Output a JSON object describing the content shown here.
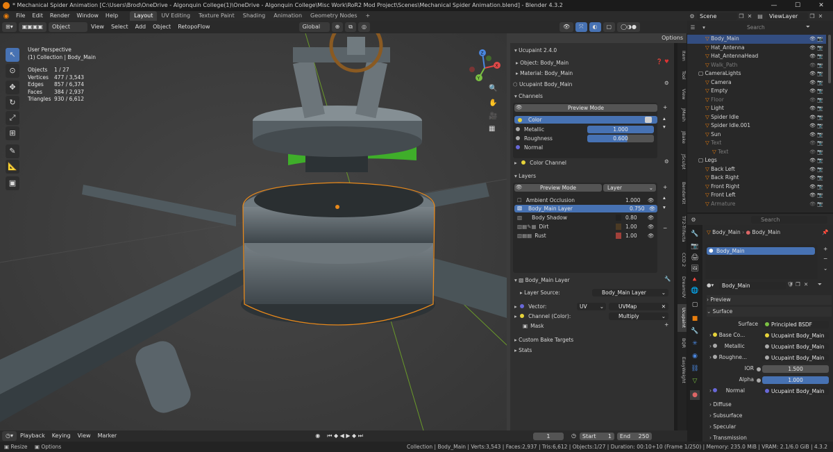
{
  "window": {
    "title": "* Mechanical Spider Animation [C:\\Users\\Brod\\OneDrive - Algonquin College(1)\\OneDrive - Algonquin College\\Misc Work\\RoR2 Mod Project\\Scenes\\Mechanical Spider Animation.blend] - Blender 4.3.2",
    "minimize": "—",
    "maximize": "☐",
    "close": "✕"
  },
  "menu": [
    "File",
    "Edit",
    "Render",
    "Window",
    "Help"
  ],
  "workspaces": [
    "Layout",
    "UV Editing",
    "Texture Paint",
    "Shading",
    "Animation",
    "Geometry Nodes"
  ],
  "scene": {
    "label": "Scene",
    "viewlayer": "ViewLayer"
  },
  "viewport_header": {
    "mode": "Object Mode",
    "items": [
      "View",
      "Select",
      "Add",
      "Object"
    ],
    "addon": "RetopoFlow",
    "transform": "Global",
    "options": "Options"
  },
  "overlay": {
    "perspective": "User Perspective",
    "collection": "(1) Collection | Body_Main",
    "stats": [
      {
        "label": "Objects",
        "value": "1 / 27"
      },
      {
        "label": "Vertices",
        "value": "477 / 3,543"
      },
      {
        "label": "Edges",
        "value": "857 / 6,374"
      },
      {
        "label": "Faces",
        "value": "384 / 2,937"
      },
      {
        "label": "Triangles",
        "value": "930 / 6,612"
      }
    ]
  },
  "gizmo": {
    "x": "X",
    "y": "Y",
    "z": "Z"
  },
  "ucupaint": {
    "version": "Ucupaint 2.4.0",
    "object": "Object: Body_Main",
    "material": "Material: Body_Main",
    "node": "Ucupaint Body_Main",
    "channels_label": "Channels",
    "preview_mode": "Preview Mode",
    "channels": [
      {
        "name": "Color",
        "value": ""
      },
      {
        "name": "Metallic",
        "value": "1.000"
      },
      {
        "name": "Roughness",
        "value": "0.600"
      },
      {
        "name": "Normal",
        "value": ""
      }
    ],
    "color_channel": "Color Channel",
    "layers_label": "Layers",
    "layer_preview": "Preview Mode",
    "layer_dropdown": "Layer",
    "layers": [
      {
        "name": "Ambient Occlusion",
        "value": "1.000"
      },
      {
        "name": "Body_Main Layer",
        "value": "0.750"
      },
      {
        "name": "Body Shadow",
        "value": "0.80"
      },
      {
        "name": "Dirt",
        "value": "1.00"
      },
      {
        "name": "Rust",
        "value": "1.00"
      }
    ],
    "active_layer": "Body_Main Layer",
    "layer_source_label": "Layer Source:",
    "layer_source": "Body_Main Layer",
    "vector_label": "Vector:",
    "vector_type": "UV",
    "vector_map": "UVMap",
    "channel_color_label": "Channel (Color):",
    "blend": "Multiply",
    "mask": "Mask",
    "custom_bake": "Custom Bake Targets",
    "stats": "Stats"
  },
  "side_tabs": [
    "Item",
    "Tool",
    "View",
    "JMesh",
    "JBake",
    "JSculpt",
    "BenderKit",
    "TF2-Trifecta",
    "CCD 2",
    "DreamUV",
    "Ucupaint",
    "BQR",
    "EasyWeight"
  ],
  "outliner": {
    "search": "Search",
    "rows": [
      {
        "name": "Body_Main",
        "indent": 2,
        "sel": true,
        "dim": false
      },
      {
        "name": "Hat_Antenna",
        "indent": 2,
        "sel": false,
        "dim": false
      },
      {
        "name": "Hat_AntennaHead",
        "indent": 2,
        "sel": false,
        "dim": false
      },
      {
        "name": "Walk_Path",
        "indent": 2,
        "sel": false,
        "dim": true
      },
      {
        "name": "CameraLights",
        "indent": 1,
        "sel": false,
        "dim": false
      },
      {
        "name": "Camera",
        "indent": 2,
        "sel": false,
        "dim": false
      },
      {
        "name": "Empty",
        "indent": 2,
        "sel": false,
        "dim": false
      },
      {
        "name": "Floor",
        "indent": 2,
        "sel": false,
        "dim": true
      },
      {
        "name": "Light",
        "indent": 2,
        "sel": false,
        "dim": false
      },
      {
        "name": "Spider Idle",
        "indent": 2,
        "sel": false,
        "dim": false
      },
      {
        "name": "Spider Idle.001",
        "indent": 2,
        "sel": false,
        "dim": false
      },
      {
        "name": "Sun",
        "indent": 2,
        "sel": false,
        "dim": false
      },
      {
        "name": "Text",
        "indent": 2,
        "sel": false,
        "dim": true
      },
      {
        "name": "Text",
        "indent": 3,
        "sel": false,
        "dim": true
      },
      {
        "name": "Legs",
        "indent": 1,
        "sel": false,
        "dim": false
      },
      {
        "name": "Back Left",
        "indent": 2,
        "sel": false,
        "dim": false
      },
      {
        "name": "Back Right",
        "indent": 2,
        "sel": false,
        "dim": false
      },
      {
        "name": "Front Right",
        "indent": 2,
        "sel": false,
        "dim": false
      },
      {
        "name": "Front Left",
        "indent": 2,
        "sel": false,
        "dim": false
      },
      {
        "name": "Armature",
        "indent": 2,
        "sel": false,
        "dim": true
      }
    ]
  },
  "properties": {
    "search": "Search",
    "breadcrumb_object": "Body_Main",
    "breadcrumb_material": "Body_Main",
    "slot": "Body_Main",
    "material_name": "Body_Main",
    "preview": "Preview",
    "surface_panel": "Surface",
    "surface_label": "Surface",
    "surface_value": "Principled BSDF",
    "inputs": [
      {
        "label": "Base Co...",
        "value": "Ucupaint Body_Main",
        "kind": "link"
      },
      {
        "label": "Metallic",
        "value": "Ucupaint Body_Main",
        "kind": "link"
      },
      {
        "label": "Roughne...",
        "value": "Ucupaint Body_Main",
        "kind": "link"
      },
      {
        "label": "IOR",
        "value": "1.500",
        "kind": "num"
      },
      {
        "label": "Alpha",
        "value": "1.000",
        "kind": "blue"
      },
      {
        "label": "Normal",
        "value": "Ucupaint Body_Main",
        "kind": "link"
      }
    ],
    "subpanels": [
      "Diffuse",
      "Subsurface",
      "Specular",
      "Transmission"
    ]
  },
  "timeline": {
    "items": [
      "Playback",
      "Keying",
      "View",
      "Marker"
    ],
    "current": "1",
    "start_label": "Start",
    "start": "1",
    "end_label": "End",
    "end": "250"
  },
  "status": {
    "left": [
      "Resize",
      "Options"
    ],
    "right": "Collection | Body_Main | Verts:3,543 | Faces:2,937 | Tris:6,612 | Objects:1/27 | Duration: 00:10+10 (Frame 1/250) | Memory: 235.0 MiB | VRAM: 2.1/6.0 GiB | 4.3.2"
  },
  "colors": {
    "accent": "#4772b3",
    "orange": "#e87d0d",
    "selection": "#334d80"
  }
}
